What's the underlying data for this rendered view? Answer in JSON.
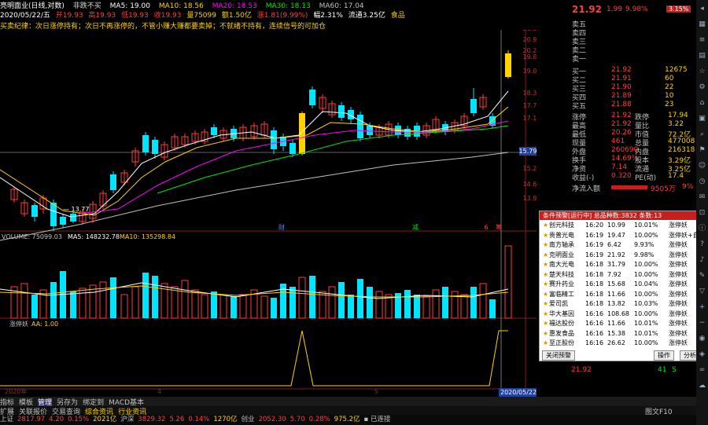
{
  "header": {
    "stock_name": "亮明面业(日线,对数)",
    "indicator": "非跌不买",
    "ma5": "MA5: 19.00",
    "ma10": "MA10: 18.56",
    "ma20": "MA20: 18.53",
    "ma30": "MA30: 18.13",
    "ma60": "MA60: 17.04",
    "date": "2020/05/22/五",
    "open": "开19.93",
    "high": "高19.93",
    "low": "低19.93",
    "close": "收19.93",
    "vol": "量75099",
    "amount": "额1.50亿",
    "change": "涨1.81(9.99%)",
    "amp": "幅2.31%",
    "turnover": "流通3.25亿",
    "sector": "食品",
    "notice": "买卖纪律：次日涨停持有；次日不再涨停的，不管小赚大赚都要卖掉；不就绪不持有，连续信号的可加仓"
  },
  "main_chart": {
    "y_labels": [
      "21.92",
      "21.54",
      "20.96",
      "20.26",
      "19.83",
      "19.08",
      "18.37",
      "17.75",
      "17.15",
      "15.79",
      "15.21",
      "14.62",
      "13.97"
    ],
    "low_mark": "13.77",
    "high_mark": "21.92",
    "crosshair_price": "15.79",
    "event_labels": [
      "财",
      "减",
      "6",
      "筹"
    ],
    "colors": {
      "up": "#ff3c3c",
      "down": "#00e5ff",
      "limit": "#ffd200",
      "ma5": "#ffffff",
      "ma10": "#ffd200",
      "ma20": "#ff00ff",
      "ma30": "#00e600",
      "ma60": "#c0c0c0"
    }
  },
  "volume_panel": {
    "title": "VOLUME: 75099.03",
    "ma5": "MA5: 148232.78",
    "ma10": "MA10: 135298.84"
  },
  "aa_panel": {
    "title": "涨停妖",
    "value": "AA: 1.00"
  },
  "x_axis": {
    "labels": [
      "2020年",
      "4",
      "5"
    ],
    "cursor_date": "2020/05/22/五"
  },
  "right_panel": {
    "price": "21.92",
    "change": "1.99",
    "pct": "9.98%",
    "badge": "3.15%",
    "sell_labels": [
      "卖五",
      "卖四",
      "卖三",
      "卖二",
      "卖一"
    ],
    "buy": [
      {
        "label": "买一",
        "price": "21.92",
        "vol": "12675"
      },
      {
        "label": "买二",
        "price": "21.91",
        "vol": "60"
      },
      {
        "label": "买三",
        "price": "21.90",
        "vol": "22"
      },
      {
        "label": "买四",
        "price": "21.89",
        "vol": "10"
      },
      {
        "label": "买五",
        "price": "21.88",
        "vol": "23"
      }
    ],
    "stats": [
      {
        "l1": "涨停",
        "v1": "21.92",
        "l2": "跌停",
        "v2": "17.94"
      },
      {
        "l1": "最高",
        "v1": "21.92",
        "l2": "量比",
        "v2": "3.22"
      },
      {
        "l1": "最低",
        "v1": "20.26",
        "l2": "市值",
        "v2": "72.2亿"
      },
      {
        "l1": "现量",
        "v1": "461",
        "l2": "总量",
        "v2": "477008"
      },
      {
        "l1": "外盘",
        "v1": "260690",
        "l2": "内盘",
        "v2": "216318"
      },
      {
        "l1": "换手",
        "v1": "14.69%",
        "l2": "股本",
        "v2": "3.29亿"
      },
      {
        "l1": "净资",
        "v1": "7.14",
        "l2": "流通",
        "v2": "3.25亿"
      },
      {
        "l1": "收益(-)",
        "v1": "0.320",
        "l2": "PE(动)",
        "v2": "17.4"
      }
    ],
    "net_inflow_label": "净流入额",
    "net_inflow_value": "9505万",
    "net_inflow_pct": "9%"
  },
  "warn_panel": {
    "header": "条件预警[运行中] 总品种数:3832 条数:13",
    "rows": [
      {
        "name": "创元科技",
        "time": "16:20",
        "price": "10.99",
        "pct": "10.01%",
        "tag": "涨停妖"
      },
      {
        "name": "贵普光电",
        "time": "16:19",
        "price": "19.47",
        "pct": "10.00%",
        "tag": "涨停妖+自"
      },
      {
        "name": "南方轴承",
        "time": "16:19",
        "price": "6.42",
        "pct": "9.93%",
        "tag": "涨停妖"
      },
      {
        "name": "克明面业",
        "time": "16:19",
        "price": "21.92",
        "pct": "9.98%",
        "tag": "涨停妖"
      },
      {
        "name": "南大光电",
        "time": "16:18",
        "price": "31.79",
        "pct": "10.00%",
        "tag": "涨停妖"
      },
      {
        "name": "楚天科技",
        "time": "16:18",
        "price": "7.92",
        "pct": "10.00%",
        "tag": "涨停妖"
      },
      {
        "name": "赛升药业",
        "time": "16:18",
        "price": "15.68",
        "pct": "10.04%",
        "tag": "涨停妖"
      },
      {
        "name": "富临精工",
        "time": "16:18",
        "price": "11.66",
        "pct": "10.00%",
        "tag": "涨停妖"
      },
      {
        "name": "爱司凯",
        "time": "16:18",
        "price": "13.82",
        "pct": "10.03%",
        "tag": "涨停妖"
      },
      {
        "name": "华大基因",
        "time": "16:16",
        "price": "108.68",
        "pct": "10.00%",
        "tag": "涨停妖"
      },
      {
        "name": "福达股份",
        "time": "16:16",
        "price": "11.66",
        "pct": "10.01%",
        "tag": "涨停妖"
      },
      {
        "name": "惠发食品",
        "time": "16:16",
        "price": "15.38",
        "pct": "10.01%",
        "tag": "涨停妖"
      },
      {
        "name": "至正股份",
        "time": "16:16",
        "price": "26.62",
        "pct": "10.00%",
        "tag": "涨停妖"
      }
    ],
    "close_btn": "关闭预警",
    "op_btn": "操作",
    "analysis_btn": "分析"
  },
  "below_warn": {
    "price": "21.92",
    "vol": "41",
    "unit": "S"
  },
  "tabs": [
    "指标",
    "模板",
    "管理",
    "另存为",
    "绑定到",
    "MACD基本"
  ],
  "sub_tabs": [
    "扩展",
    "关联报价",
    "交易查询",
    "综合资讯",
    "行业资讯"
  ],
  "status": {
    "items": [
      {
        "name": "上证",
        "val": "2817.97",
        "chg": "4.20",
        "pct": "0.15%",
        "amt": "2021亿"
      },
      {
        "name": "沪深",
        "val": "3829.32",
        "chg": "5.26",
        "pct": "0.14%",
        "amt": "1270亿"
      },
      {
        "name": "创业",
        "val": "2052.30",
        "chg": "5.70",
        "pct": "0.28%",
        "amt": "975.2亿"
      }
    ],
    "connection": "已连接",
    "brand": "图文F10"
  },
  "strip_icons": [
    "arrow-icon",
    "chart-icon",
    "list-icon",
    "grid-icon",
    "star-icon",
    "gear-icon",
    "home-icon",
    "book-icon",
    "search-icon",
    "flag-icon",
    "user-icon",
    "clock-icon",
    "mail-icon",
    "lock-icon",
    "info-icon",
    "help-icon",
    "bell-icon",
    "tool-icon",
    "filter-icon",
    "plus-icon",
    "minus-icon",
    "pin-icon",
    "tag-icon",
    "link-icon",
    "cloud-icon"
  ]
}
